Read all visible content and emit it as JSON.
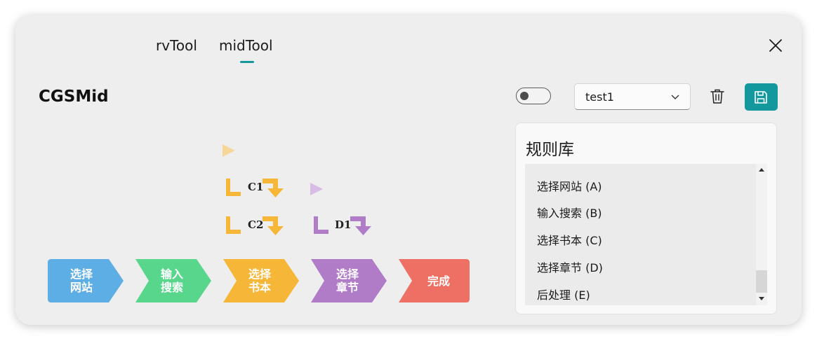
{
  "tabs": [
    {
      "label": "rvTool",
      "selected": false
    },
    {
      "label": "midTool",
      "selected": true
    }
  ],
  "page": {
    "title": "CGSMid"
  },
  "toolbar": {
    "toggle_on": false,
    "profile_value": "test1"
  },
  "steps": [
    {
      "lines": [
        "选择",
        "网站"
      ],
      "color": "#5eaee6"
    },
    {
      "lines": [
        "输入",
        "搜索"
      ],
      "color": "#58d68c"
    },
    {
      "lines": [
        "选择",
        "书本"
      ],
      "color": "#f6b637"
    },
    {
      "lines": [
        "选择",
        "章节"
      ],
      "color": "#b07cc8"
    },
    {
      "lines": [
        "完成"
      ],
      "color": "#ee6f63"
    }
  ],
  "flow_nodes": [
    {
      "label": "C1",
      "color": "#f6b637"
    },
    {
      "label": "C2",
      "color": "#f6b637"
    },
    {
      "label": "D1",
      "color": "#b07cc8"
    }
  ],
  "play_markers": {
    "yellow": "#f7d699",
    "purple": "#d8bce6"
  },
  "rules": {
    "title": "规则库",
    "items": [
      "选择网站 (A)",
      "输入搜索 (B)",
      "选择书本 (C)",
      "选择章节 (D)",
      "后处理 (E)"
    ]
  },
  "colors": {
    "accent": "#13989e",
    "window_bg": "#eeeeee"
  }
}
